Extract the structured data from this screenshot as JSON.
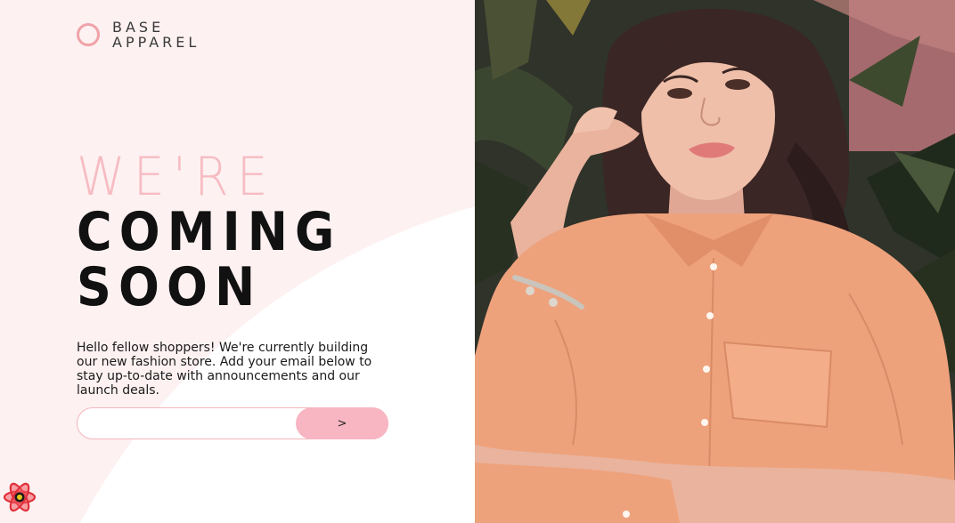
{
  "brand": {
    "line1": "BASE",
    "line2": "APPAREL"
  },
  "hero": {
    "light": "WE'RE",
    "bold1": "COMING",
    "bold2": "SOON"
  },
  "description": "Hello fellow shoppers! We're currently building our new fashion store. Add your email below to stay up-to-date with announcements and our launch deals.",
  "form": {
    "email_value": "",
    "email_placeholder": "",
    "submit_label": ">"
  },
  "colors": {
    "accent_pink": "#f6bcc2",
    "button_pink": "#f8b6c2",
    "logo_ring": "#f0a3a8",
    "shirt_orange": "#eea27c"
  },
  "icons": {
    "logo": "circle-outline-icon",
    "corner": "react-logo-icon"
  },
  "photo": {
    "subject": "woman-in-orange-shirt-photo"
  }
}
